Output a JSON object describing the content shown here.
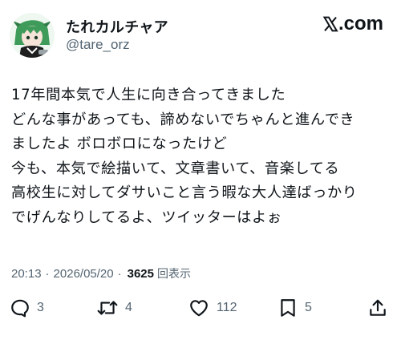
{
  "author": {
    "name": "たれカルチャア",
    "handle": "@tare_orz"
  },
  "brand": {
    "label": "X.com",
    "logo_text": "X",
    "domain_text": ".com"
  },
  "post": {
    "lines": [
      "17年間本気で人生に向き合ってきました",
      "どんな事があっても、諦めないでちゃんと進んでき",
      "ましたよ ボロボロになったけど",
      "今も、本気で絵描いて、文章書いて、音楽してる",
      "高校生に対してダサいこと言う暇な大人達ばっかり",
      "でげんなりしてるよ、ツイッターはよぉ"
    ]
  },
  "meta": {
    "time": "20:13",
    "separator": "·",
    "date": "2026/05/20",
    "views": "3625",
    "views_label": "回表示"
  },
  "actions": {
    "replies": "3",
    "reposts": "4",
    "likes": "112",
    "bookmarks": "5"
  },
  "icons": {
    "reply": "reply-icon",
    "repost": "repost-icon",
    "like": "heart-icon",
    "bookmark": "bookmark-icon",
    "share": "share-icon"
  },
  "colors": {
    "text": "#0f1419",
    "secondary": "#536471",
    "background": "#ffffff"
  }
}
